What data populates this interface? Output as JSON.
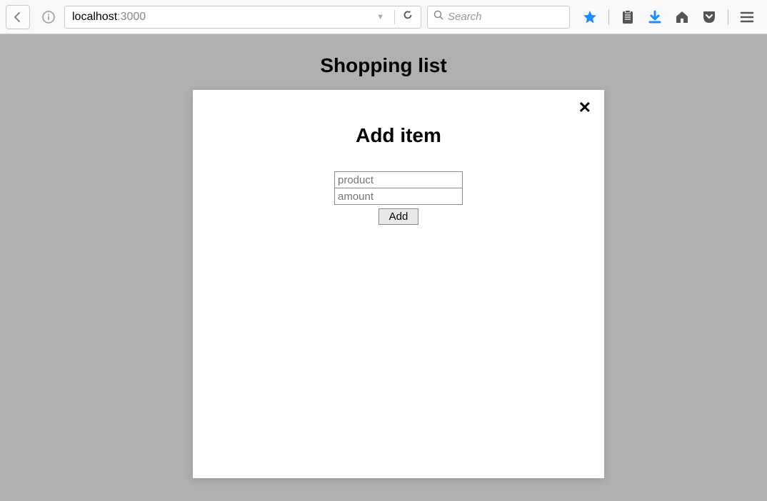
{
  "browser": {
    "url_host": "localhost",
    "url_port": ":3000",
    "search_placeholder": "Search"
  },
  "page": {
    "title": "Shopping list"
  },
  "modal": {
    "title": "Add item",
    "product_placeholder": "product",
    "amount_placeholder": "amount",
    "add_button": "Add",
    "close_label": "✕"
  }
}
